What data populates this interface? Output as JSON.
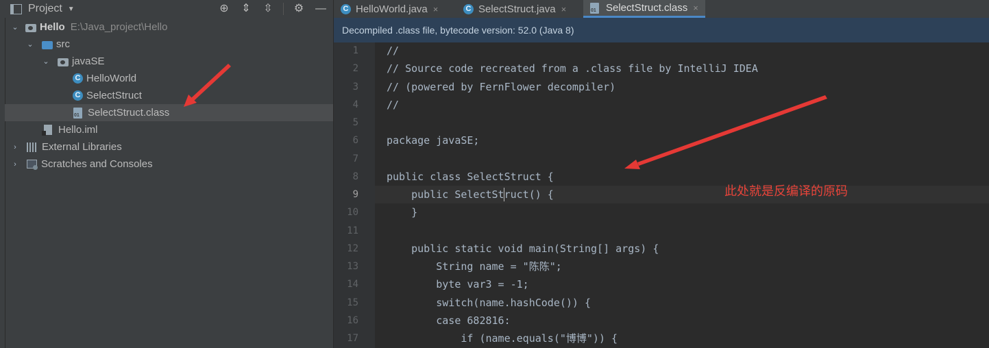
{
  "project_panel": {
    "title": "Project",
    "tree": [
      {
        "label": "Hello",
        "path": "E:\\Java_project\\Hello",
        "arrow": "⌄"
      },
      {
        "label": "src",
        "arrow": "⌄"
      },
      {
        "label": "javaSE",
        "arrow": "⌄"
      },
      {
        "label": "HelloWorld"
      },
      {
        "label": "SelectStruct"
      },
      {
        "label": "SelectStruct.class"
      },
      {
        "label": "Hello.iml"
      },
      {
        "label": "External Libraries",
        "arrow": "›"
      },
      {
        "label": "Scratches and Consoles",
        "arrow": "›"
      }
    ]
  },
  "tabs": [
    {
      "label": "HelloWorld.java",
      "close": "×"
    },
    {
      "label": "SelectStruct.java",
      "close": "×"
    },
    {
      "label": "SelectStruct.class",
      "close": "×"
    }
  ],
  "banner": {
    "text": "Decompiled .class file, bytecode version: 52.0 (Java 8)"
  },
  "editor": {
    "line_numbers": [
      "1",
      "2",
      "3",
      "4",
      "5",
      "6",
      "7",
      "8",
      "9",
      "10",
      "11",
      "12",
      "13",
      "14",
      "15",
      "16",
      "17"
    ],
    "lines": [
      "//",
      "// Source code recreated from a .class file by IntelliJ IDEA",
      "// (powered by FernFlower decompiler)",
      "//",
      "",
      "package javaSE;",
      "",
      "public class SelectStruct {",
      "    public SelectStruct() {",
      "    }",
      "",
      "    public static void main(String[] args) {",
      "        String name = \"陈陈\";",
      "        byte var3 = -1;",
      "        switch(name.hashCode()) {",
      "        case 682816:",
      "            if (name.equals(\"博博\")) {"
    ]
  },
  "annotation": {
    "text": "此处就是反编译的原码",
    "color": "#e8443a"
  },
  "colors": {
    "accent": "#4a88c7",
    "selection": "#4b4d4f",
    "banner": "#2d4158"
  }
}
